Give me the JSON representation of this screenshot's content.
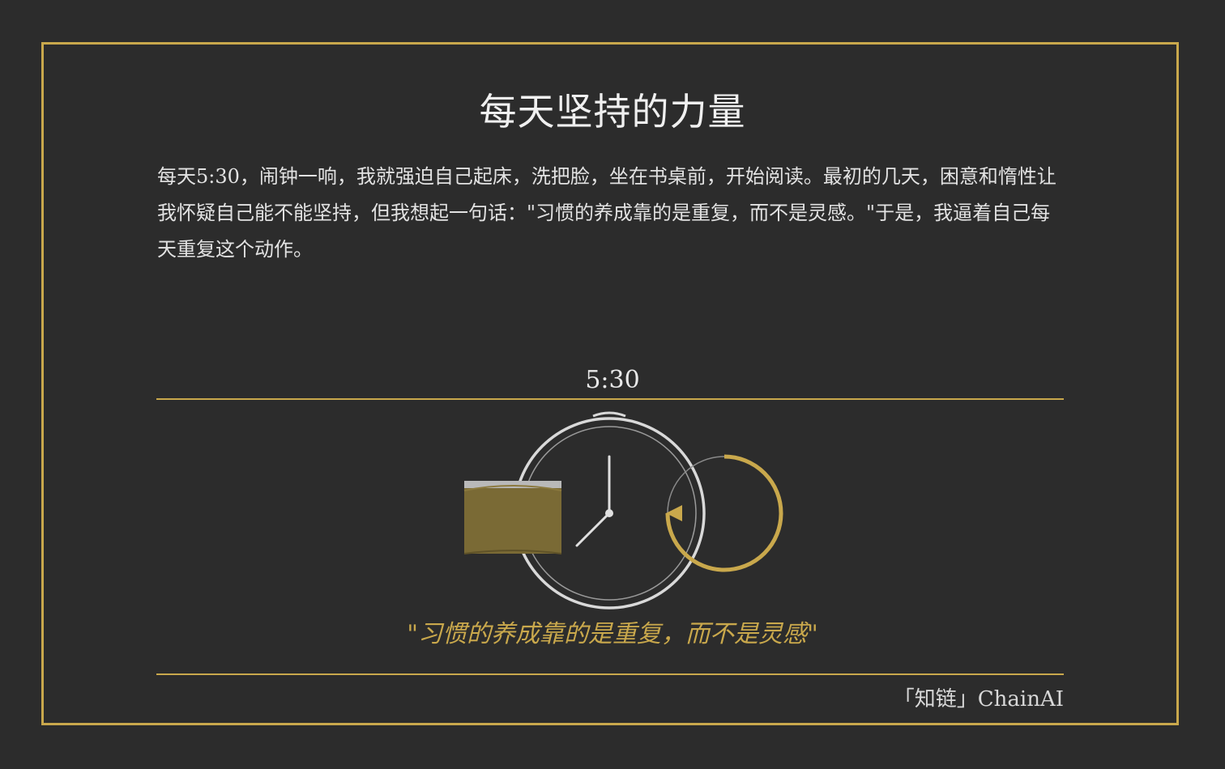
{
  "title": "每天坚持的力量",
  "paragraph": "每天5:30，闹钟一响，我就强迫自己起床，洗把脸，坐在书桌前，开始阅读。最初的几天，困意和惰性让我怀疑自己能不能坚持，但我想起一句话：\"习惯的养成靠的是重复，而不是灵感。\"于是，我逼着自己每天重复这个动作。",
  "illustration": {
    "time_label": "5:30",
    "icons": [
      "alarm-clock-icon",
      "book-icon",
      "repeat-cycle-icon"
    ]
  },
  "quote": "\"习惯的养成靠的是重复，而不是灵感\"",
  "signature": "「知链」ChainAI",
  "colors": {
    "background": "#2c2c2c",
    "accent_gold": "#c9a84c",
    "book_fill": "#7a6a35",
    "text_light": "#e6e6e6",
    "clock_stroke": "#d9d9d9"
  }
}
